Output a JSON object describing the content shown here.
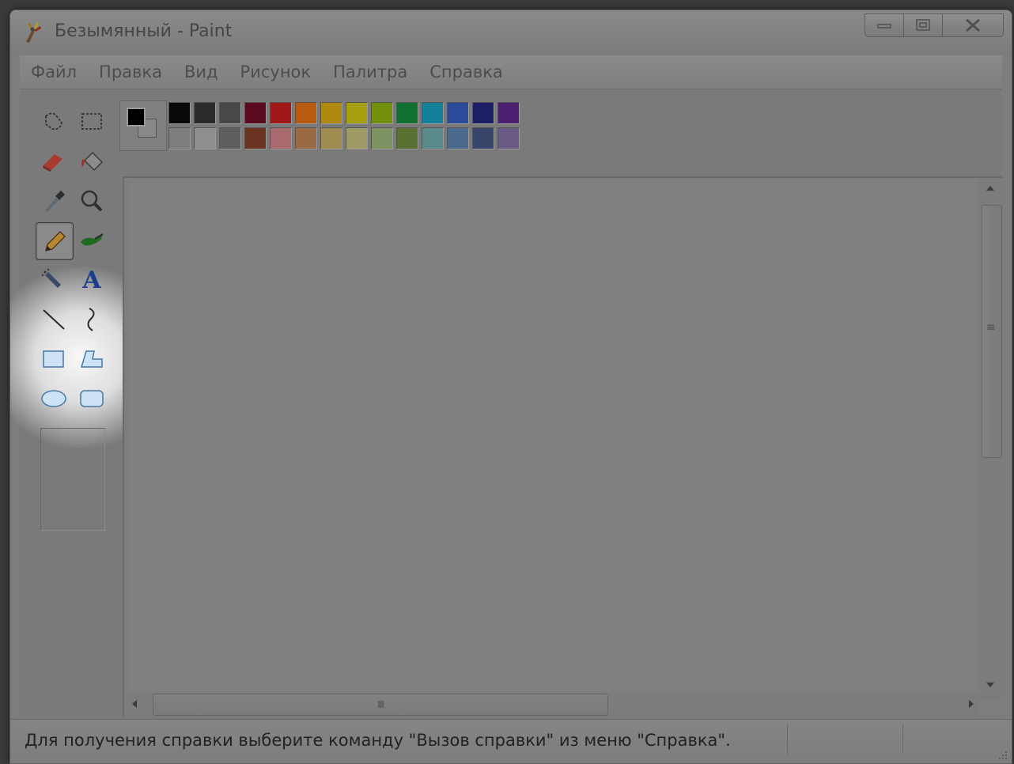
{
  "window": {
    "title": "Безымянный - Paint",
    "app_icon": "paint-brush-icon"
  },
  "menu": [
    "Файл",
    "Правка",
    "Вид",
    "Рисунок",
    "Палитра",
    "Справка"
  ],
  "tools": [
    {
      "name": "free-form-select",
      "icon": "free-select-icon"
    },
    {
      "name": "rect-select",
      "icon": "rect-select-icon"
    },
    {
      "name": "eraser",
      "icon": "eraser-icon"
    },
    {
      "name": "fill",
      "icon": "fill-bucket-icon"
    },
    {
      "name": "pick-color",
      "icon": "eyedropper-icon"
    },
    {
      "name": "magnifier",
      "icon": "magnifier-icon"
    },
    {
      "name": "pencil",
      "icon": "pencil-icon",
      "selected": true
    },
    {
      "name": "brush",
      "icon": "brush-icon"
    },
    {
      "name": "airbrush",
      "icon": "airbrush-icon"
    },
    {
      "name": "text",
      "icon": "text-icon",
      "glyph": "A"
    },
    {
      "name": "line",
      "icon": "line-icon"
    },
    {
      "name": "curve",
      "icon": "curve-icon"
    },
    {
      "name": "rectangle",
      "icon": "rectangle-icon"
    },
    {
      "name": "polygon",
      "icon": "polygon-icon"
    },
    {
      "name": "ellipse",
      "icon": "ellipse-icon"
    },
    {
      "name": "rounded-rectangle",
      "icon": "rounded-rect-icon"
    }
  ],
  "colors": {
    "foreground": "#000000",
    "background": "#808080",
    "row1": [
      "#080808",
      "#2b2b2b",
      "#484848",
      "#5a0a1e",
      "#a01818",
      "#b85a10",
      "#b08a10",
      "#a6a010",
      "#70900e",
      "#127030",
      "#14809a",
      "#2c4a9a",
      "#1c1e66",
      "#4c1e70"
    ],
    "row2": [
      "#7e7e7e",
      "#8e8e8e",
      "#5e5e5e",
      "#6a3420",
      "#a86a6e",
      "#9a6a44",
      "#9e8c50",
      "#a09a64",
      "#7e9262",
      "#5a7030",
      "#5a8a8a",
      "#4a6a8e",
      "#38456a",
      "#6a5a86"
    ]
  },
  "status": {
    "text": "Для получения справки выберите команду \"Вызов справки\" из меню \"Справка\"."
  },
  "scrollbars": {
    "h_grip": "III",
    "v_grip": "≡"
  }
}
